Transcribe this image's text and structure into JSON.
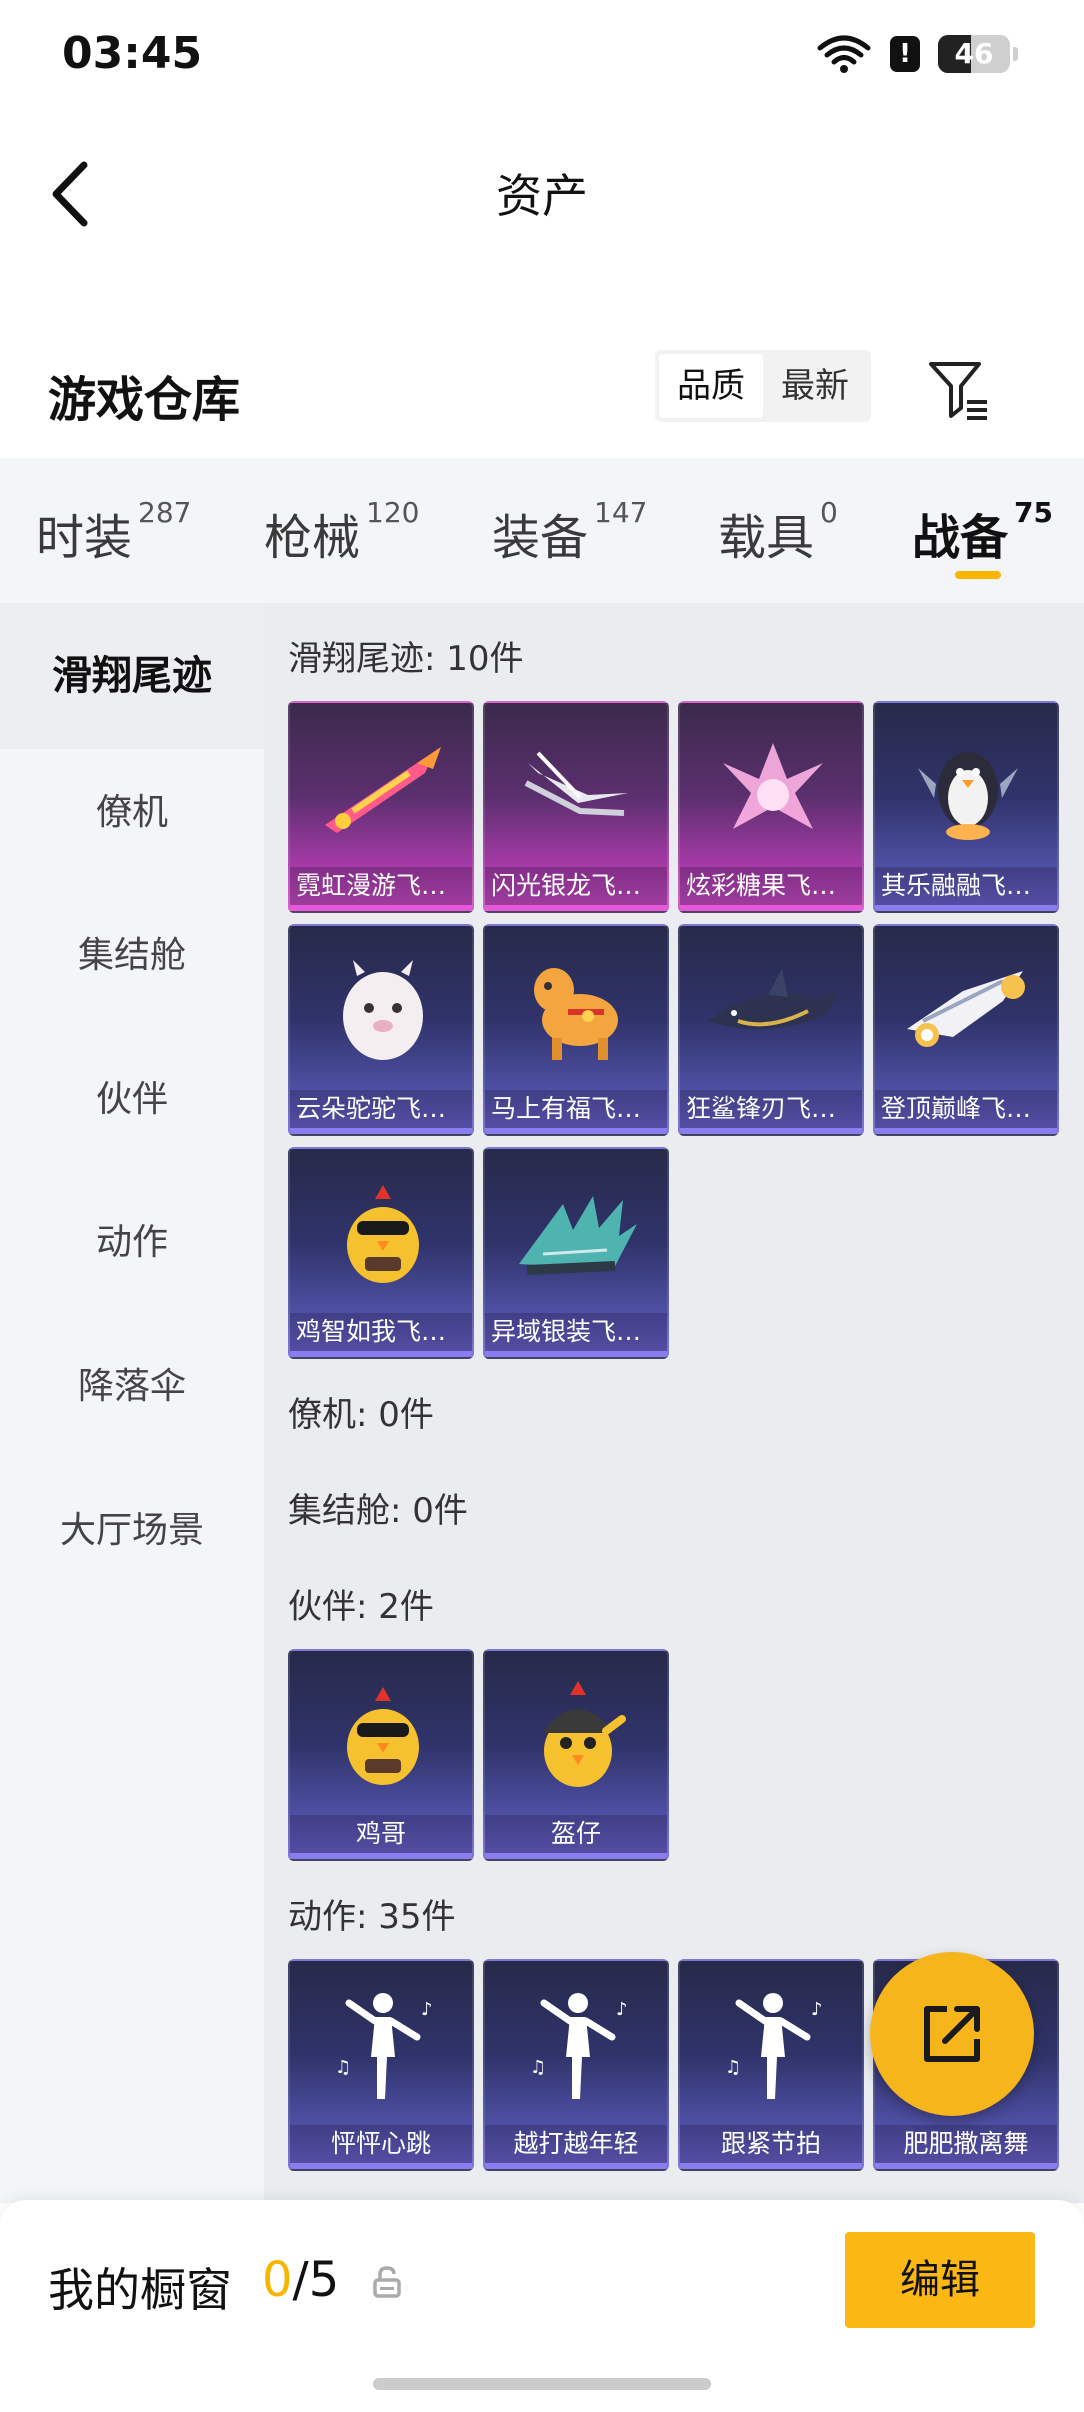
{
  "status_bar": {
    "time": "03:45",
    "battery": "46",
    "battery_level": 0.46
  },
  "header": {
    "title": "资产"
  },
  "section": {
    "title": "游戏仓库",
    "sort_options": [
      "品质",
      "最新"
    ],
    "sort_active": "品质"
  },
  "tabs": [
    {
      "label": "时装",
      "count": "287"
    },
    {
      "label": "枪械",
      "count": "120"
    },
    {
      "label": "装备",
      "count": "147"
    },
    {
      "label": "载具",
      "count": "0"
    },
    {
      "label": "战备",
      "count": "75"
    }
  ],
  "active_tab": "战备",
  "sidebar": [
    "滑翔尾迹",
    "僚机",
    "集结舱",
    "伙伴",
    "动作",
    "降落伞",
    "大厅场景"
  ],
  "groups": {
    "glide": {
      "title": "滑翔尾迹: 10件",
      "items": [
        {
          "label": "霓虹漫游飞行器",
          "icon": "neon-rocket-icon",
          "rarity": "pink"
        },
        {
          "label": "闪光银龙飞行器",
          "icon": "silver-dragon-wings-icon",
          "rarity": "pink"
        },
        {
          "label": "炫彩糖果飞行器",
          "icon": "candy-crystal-icon",
          "rarity": "pink"
        },
        {
          "label": "其乐融融飞行器",
          "icon": "penguin-icon",
          "rarity": "blue"
        },
        {
          "label": "云朵驼驼飞行器",
          "icon": "alpaca-icon",
          "rarity": "blue"
        },
        {
          "label": "马上有福飞行器",
          "icon": "horse-icon",
          "rarity": "blue"
        },
        {
          "label": "狂鲨锋刃飞行器",
          "icon": "shark-icon",
          "rarity": "blue"
        },
        {
          "label": "登顶巅峰飞行器",
          "icon": "jet-icon",
          "rarity": "blue"
        },
        {
          "label": "鸡智如我飞行器",
          "icon": "chick-icon",
          "rarity": "blue"
        },
        {
          "label": "异域银装飞行器",
          "icon": "spiked-wing-icon",
          "rarity": "blue"
        }
      ]
    },
    "wingman": {
      "title": "僚机: 0件"
    },
    "pod": {
      "title": "集结舱: 0件"
    },
    "partner": {
      "title": "伙伴: 2件",
      "items": [
        {
          "label": "鸡哥",
          "icon": "chicken-sunglasses-icon",
          "rarity": "blue"
        },
        {
          "label": "盔仔",
          "icon": "chicken-helmet-icon",
          "rarity": "blue"
        }
      ]
    },
    "emote": {
      "title": "动作: 35件",
      "items": [
        {
          "label": "怦怦心跳",
          "icon": "dancer-icon",
          "rarity": "blue"
        },
        {
          "label": "越打越年轻",
          "icon": "dancer-icon",
          "rarity": "blue"
        },
        {
          "label": "跟紧节拍",
          "icon": "dancer-icon",
          "rarity": "blue"
        },
        {
          "label": "肥肥撒离舞",
          "icon": "dancer-icon",
          "rarity": "blue"
        }
      ]
    }
  },
  "showcase": {
    "label": "我的橱窗",
    "used": "0",
    "separator": "/",
    "total": "5"
  },
  "edit_button": "编辑",
  "colors": {
    "accent": "#f7b500",
    "rarity_pink": "#d24fc9",
    "rarity_blue": "#6e66d2"
  }
}
